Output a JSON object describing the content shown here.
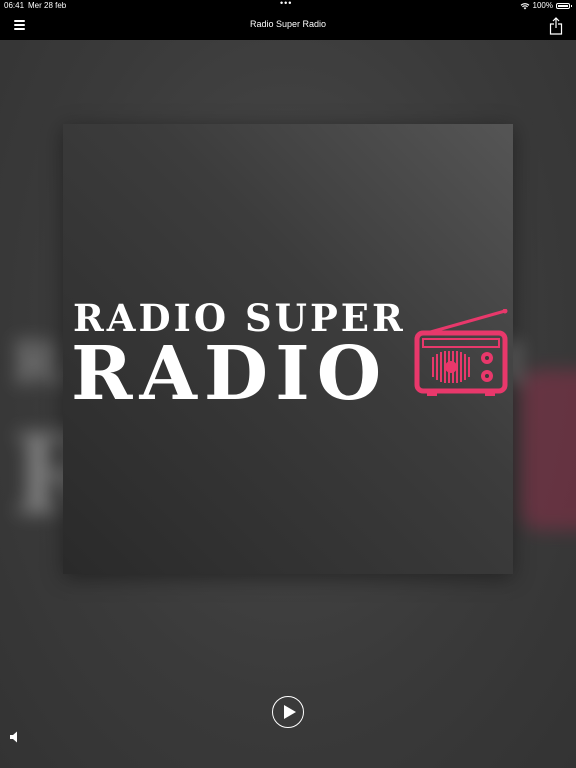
{
  "status": {
    "time": "06:41",
    "date": "Mer 28 feb",
    "dots": "•••",
    "battery": "100%"
  },
  "navbar": {
    "title": "Radio Super Radio",
    "menu_icon": "hamburger-menu-icon",
    "share_icon": "share-icon"
  },
  "artwork": {
    "logo_line1": "RADIO SUPER",
    "logo_line2": "RADIO",
    "logo_icon": "radio-icon",
    "accent_color": "#e8386b"
  },
  "controls": {
    "play_icon": "play-icon",
    "volume_icon": "speaker-icon"
  }
}
